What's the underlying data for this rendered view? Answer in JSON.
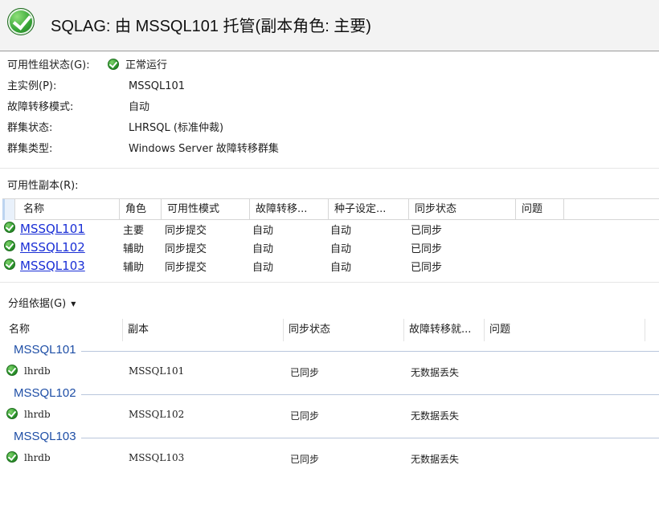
{
  "header": {
    "title": "SQLAG: 由 MSSQL101 托管(副本角色: 主要)"
  },
  "properties": [
    {
      "label": "可用性组状态(G):",
      "value": "正常运行",
      "status_icon": "green-check-icon"
    },
    {
      "label": "主实例(P):",
      "value": "MSSQL101"
    },
    {
      "label": "故障转移模式:",
      "value": "自动"
    },
    {
      "label": "群集状态:",
      "value": "LHRSQL (标准仲裁)"
    },
    {
      "label": "群集类型:",
      "value": "Windows Server 故障转移群集"
    }
  ],
  "replicas_section": {
    "label": "可用性副本(R):",
    "columns": [
      "名称",
      "角色",
      "可用性模式",
      "故障转移...",
      "种子设定...",
      "同步状态",
      "问题"
    ],
    "rows": [
      {
        "name": "MSSQL101",
        "role": "主要",
        "availability_mode": "同步提交",
        "failover": "自动",
        "seeding": "自动",
        "sync_state": "已同步"
      },
      {
        "name": "MSSQL102",
        "role": "辅助",
        "availability_mode": "同步提交",
        "failover": "自动",
        "seeding": "自动",
        "sync_state": "已同步"
      },
      {
        "name": "MSSQL103",
        "role": "辅助",
        "availability_mode": "同步提交",
        "failover": "自动",
        "seeding": "自动",
        "sync_state": "已同步"
      }
    ]
  },
  "group_by": {
    "label": "分组依据(G)"
  },
  "databases_list": {
    "columns": [
      "名称",
      "副本",
      "同步状态",
      "故障转移就...",
      "问题"
    ],
    "groups": [
      {
        "header": "MSSQL101",
        "rows": [
          {
            "name": "lhrdb",
            "replica": "MSSQL101",
            "sync_state": "已同步",
            "failover_readiness": "无数据丢失"
          }
        ]
      },
      {
        "header": "MSSQL102",
        "rows": [
          {
            "name": "lhrdb",
            "replica": "MSSQL102",
            "sync_state": "已同步",
            "failover_readiness": "无数据丢失"
          }
        ]
      },
      {
        "header": "MSSQL103",
        "rows": [
          {
            "name": "lhrdb",
            "replica": "MSSQL103",
            "sync_state": "已同步",
            "failover_readiness": "无数据丢失"
          }
        ]
      }
    ]
  },
  "colors": {
    "link": "#1a2fd6",
    "group_header": "#1e4ea6",
    "status_ok": "#2f9a2f"
  }
}
